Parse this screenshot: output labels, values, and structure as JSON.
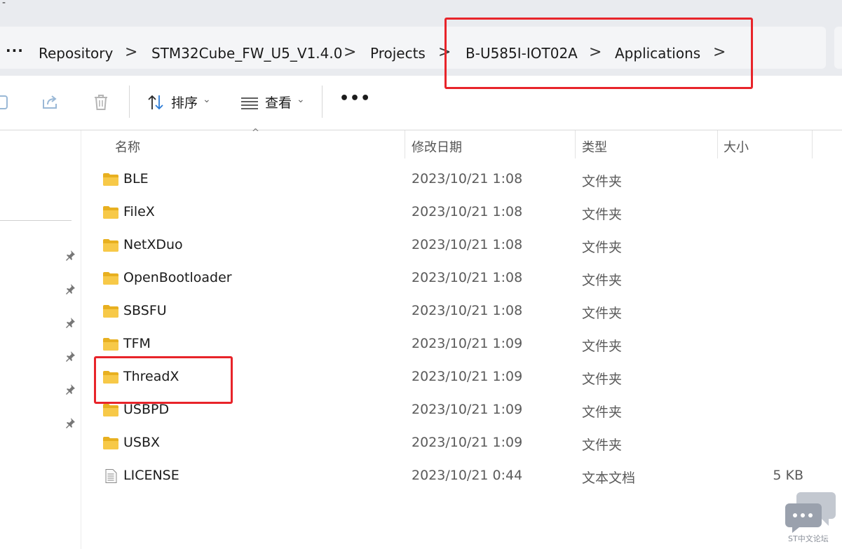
{
  "titlebar": {
    "dash": "-"
  },
  "breadcrumb": {
    "more": "···",
    "items": [
      "Repository",
      "STM32Cube_FW_U5_V1.4.0",
      "Projects",
      "B-U585I-IOT02A",
      "Applications"
    ],
    "separator": ">"
  },
  "toolbar": {
    "sort_label": "排序",
    "view_label": "查看",
    "more": "•••",
    "caret": "⌄",
    "icons": [
      "partial-icon",
      "share-icon",
      "delete-icon",
      "sort-icon",
      "view-icon",
      "more-icon"
    ]
  },
  "columns": {
    "name": "名称",
    "date": "修改日期",
    "type": "类型",
    "size": "大小",
    "sort_indicator": "^"
  },
  "files": [
    {
      "name": "BLE",
      "date": "2023/10/21 1:08",
      "type": "文件夹",
      "size": "",
      "kind": "folder"
    },
    {
      "name": "FileX",
      "date": "2023/10/21 1:08",
      "type": "文件夹",
      "size": "",
      "kind": "folder"
    },
    {
      "name": "NetXDuo",
      "date": "2023/10/21 1:08",
      "type": "文件夹",
      "size": "",
      "kind": "folder"
    },
    {
      "name": "OpenBootloader",
      "date": "2023/10/21 1:08",
      "type": "文件夹",
      "size": "",
      "kind": "folder"
    },
    {
      "name": "SBSFU",
      "date": "2023/10/21 1:08",
      "type": "文件夹",
      "size": "",
      "kind": "folder"
    },
    {
      "name": "TFM",
      "date": "2023/10/21 1:09",
      "type": "文件夹",
      "size": "",
      "kind": "folder"
    },
    {
      "name": "ThreadX",
      "date": "2023/10/21 1:09",
      "type": "文件夹",
      "size": "",
      "kind": "folder"
    },
    {
      "name": "USBPD",
      "date": "2023/10/21 1:09",
      "type": "文件夹",
      "size": "",
      "kind": "folder"
    },
    {
      "name": "USBX",
      "date": "2023/10/21 1:09",
      "type": "文件夹",
      "size": "",
      "kind": "folder"
    },
    {
      "name": "LICENSE",
      "date": "2023/10/21 0:44",
      "type": "文本文档",
      "size": "5 KB",
      "kind": "file"
    }
  ],
  "watermark": {
    "text": "ST中文论坛"
  },
  "colors": {
    "highlight": "#e8242a",
    "folder": "#f7c948",
    "folder_dark": "#e8b020",
    "chrome": "#e9ebef"
  }
}
